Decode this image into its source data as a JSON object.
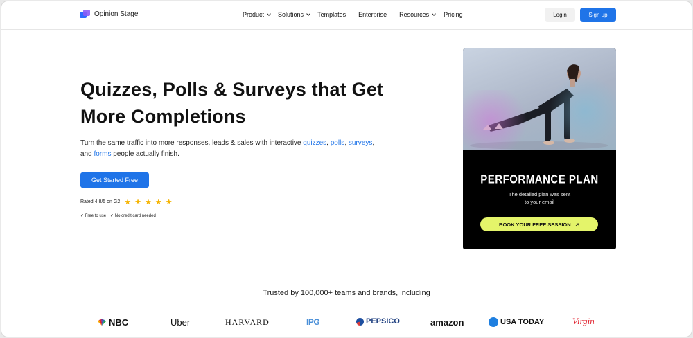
{
  "header": {
    "logo_text": "Opinion Stage",
    "nav": [
      {
        "label": "Product",
        "dropdown": true
      },
      {
        "label": "Solutions",
        "dropdown": true
      },
      {
        "label": "Templates",
        "dropdown": false
      },
      {
        "label": "Enterprise",
        "dropdown": false
      },
      {
        "label": "Resources",
        "dropdown": true
      },
      {
        "label": "Pricing",
        "dropdown": false
      }
    ],
    "login_label": "Login",
    "signup_label": "Sign up"
  },
  "hero": {
    "title_line1": "Quizzes, Polls & Surveys that Get",
    "title_line2": "More Completions",
    "desc_part1": "Turn the same traffic into more responses, leads & sales with interactive ",
    "link_quizzes": "quizzes",
    "sep1": ", ",
    "link_polls": "polls",
    "sep2": ", ",
    "link_surveys": "surveys",
    "sep3": ",",
    "desc_and": "and ",
    "link_forms": "forms",
    "desc_part2": " people actually finish.",
    "cta_label": "Get Started Free",
    "rating_text": "Rated 4.8/5 on G2",
    "stars": 5,
    "check1": "✓ Free to use",
    "check2": "✓ No credit card needed"
  },
  "card": {
    "title": "PERFORMANCE PLAN",
    "subtitle_line1": "The detailed plan was sent",
    "subtitle_line2": "to your email",
    "button_label": "BOOK YOUR FREE SESSION"
  },
  "trusted": {
    "text": "Trusted by 100,000+ teams and brands, including",
    "brands": [
      "NBC",
      "Uber",
      "HARVARD",
      "IPG",
      "PEPSICO",
      "amazon",
      "USA TODAY",
      "Virgin"
    ]
  },
  "colors": {
    "primary": "#1f74e8",
    "star": "#f5b300",
    "card_button": "#e4f46a"
  }
}
